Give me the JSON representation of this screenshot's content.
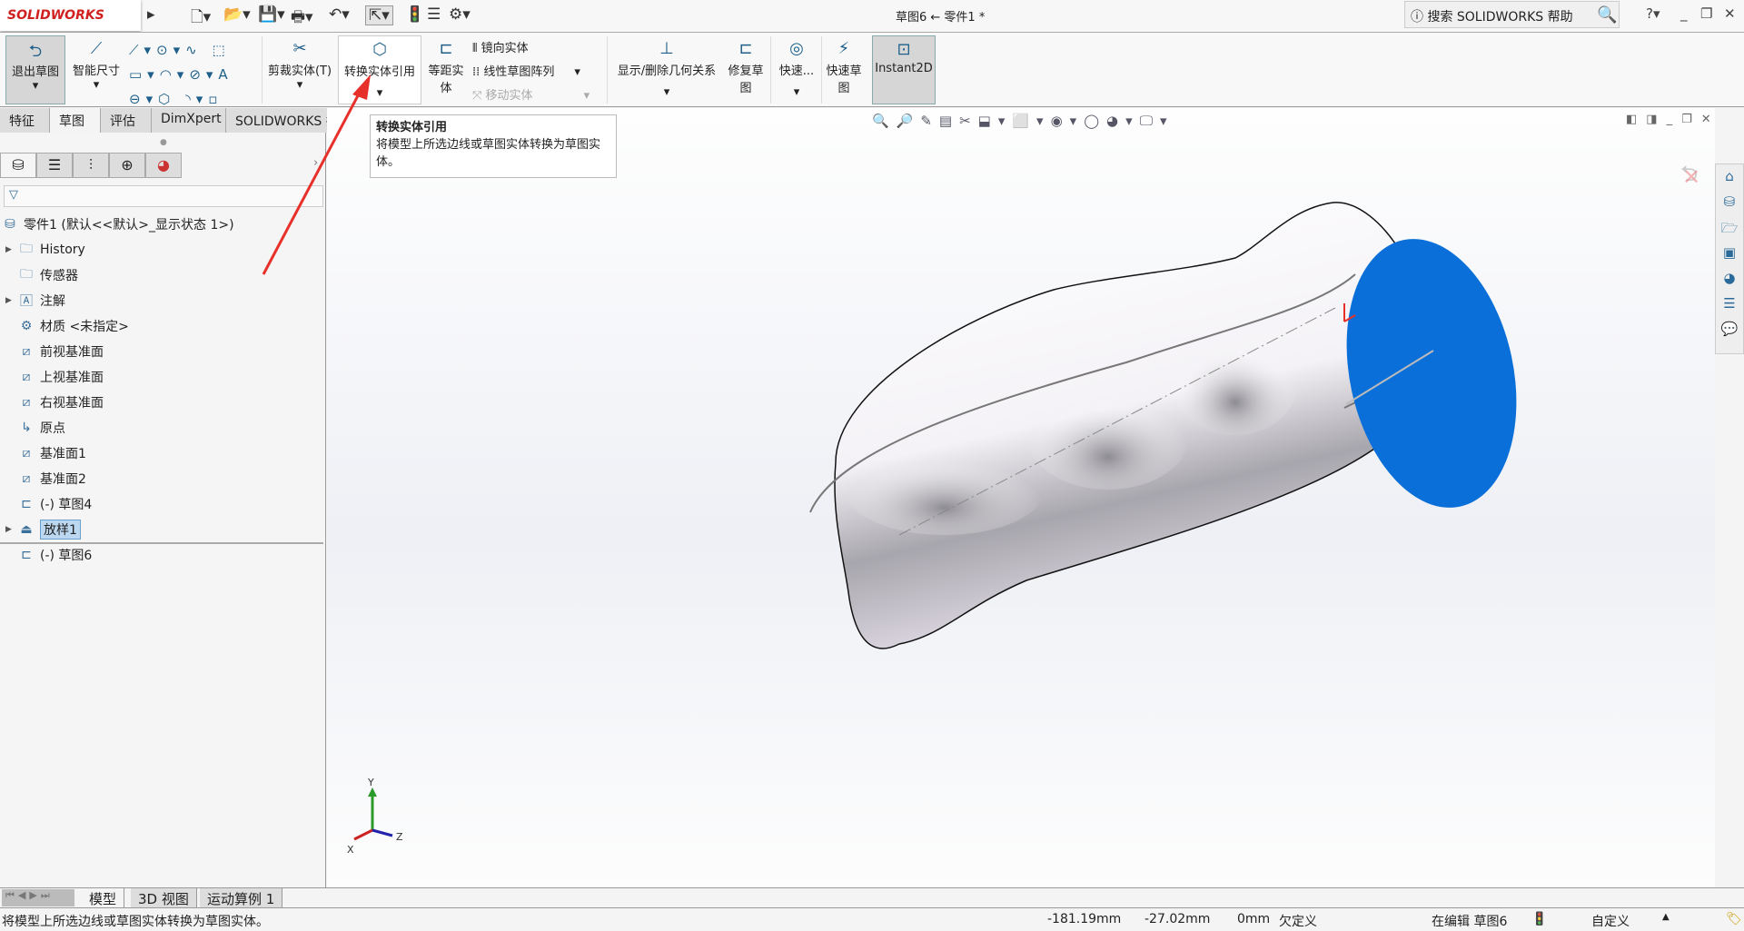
{
  "app": {
    "logo": "SOLIDWORKS",
    "title": "草图6 ← 零件1 *",
    "search_placeholder": "搜索 SOLIDWORKS 帮助"
  },
  "ribbon": {
    "exit_sketch": "退出草图",
    "smart_dim": "智能尺寸",
    "trim": "剪裁实体(T)",
    "convert": "转换实体引用",
    "offset": "等距实体",
    "mirror": "镜向实体",
    "linear_pattern": "线性草图阵列",
    "move": "移动实体",
    "relations": "显示/删除几何关系",
    "repair": "修复草图",
    "quick_snaps": "快速...",
    "rapid_sketch": "快速草图",
    "instant2d": "Instant2D"
  },
  "tabs": [
    "特征",
    "草图",
    "评估",
    "DimXpert",
    "SOLIDWORKS 插件"
  ],
  "tooltip": {
    "title": "转换实体引用",
    "body": "将模型上所选边线或草图实体转换为草图实体。"
  },
  "tree": {
    "root": "零件1  (默认<<默认>_显示状态 1>)",
    "items": [
      {
        "label": "History",
        "icon": "history-folder-icon",
        "expand": true
      },
      {
        "label": "传感器",
        "icon": "sensor-folder-icon",
        "expand": false
      },
      {
        "label": "注解",
        "icon": "annotation-folder-icon",
        "expand": true
      },
      {
        "label": "材质 <未指定>",
        "icon": "material-icon",
        "expand": false
      },
      {
        "label": "前视基准面",
        "icon": "plane-icon",
        "expand": false
      },
      {
        "label": "上视基准面",
        "icon": "plane-icon",
        "expand": false
      },
      {
        "label": "右视基准面",
        "icon": "plane-icon",
        "expand": false
      },
      {
        "label": "原点",
        "icon": "origin-icon",
        "expand": false
      },
      {
        "label": "基准面1",
        "icon": "plane-icon",
        "expand": false
      },
      {
        "label": "基准面2",
        "icon": "plane-icon",
        "expand": false
      },
      {
        "label": "(-) 草图4",
        "icon": "sketch-icon",
        "expand": false
      },
      {
        "label": "放样1",
        "icon": "loft-icon",
        "expand": true,
        "selected": true
      },
      {
        "label": "(-) 草图6",
        "icon": "sketch-icon",
        "expand": false
      }
    ]
  },
  "bottom_tabs": [
    "模型",
    "3D 视图",
    "运动算例 1"
  ],
  "status": {
    "message": "将模型上所选边线或草图实体转换为草图实体。",
    "x": "-181.19mm",
    "y": "-27.02mm",
    "z": "0mm",
    "state": "欠定义",
    "editing": "在编辑 草图6",
    "units": "自定义"
  },
  "colors": {
    "face": "#0a6fd8",
    "arrow": "#e8302a"
  }
}
